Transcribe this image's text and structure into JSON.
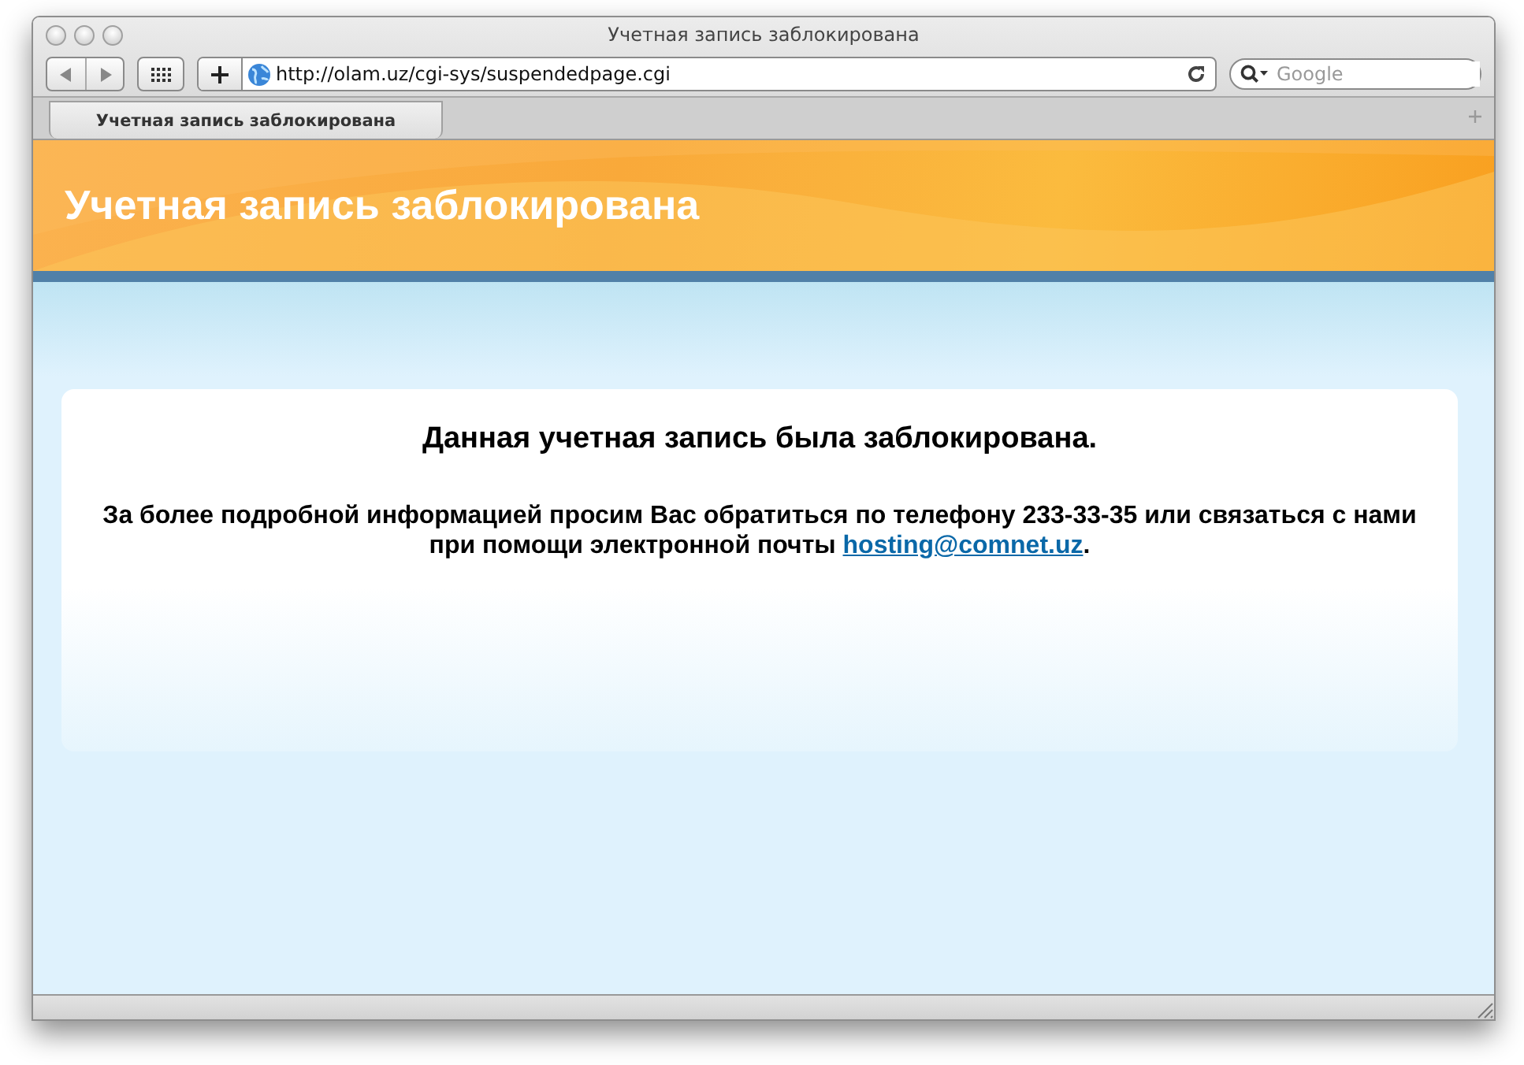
{
  "window": {
    "title": "Учетная запись заблокирована"
  },
  "toolbar": {
    "url": "http://olam.uz/cgi-sys/suspendedpage.cgi",
    "search": {
      "placeholder": "Google"
    }
  },
  "tabs": [
    {
      "label": "Учетная запись заблокирована",
      "selected": true
    }
  ],
  "page": {
    "header_title": "Учетная запись заблокирована",
    "notice": {
      "heading": "Данная учетная запись была заблокирована.",
      "text_before": "За более подробной информацией просим Вас обратиться по телефону 233-33-35 или связаться с нами при помощи электронной почты ",
      "link": "hosting@comnet.uz",
      "text_after": "."
    }
  }
}
